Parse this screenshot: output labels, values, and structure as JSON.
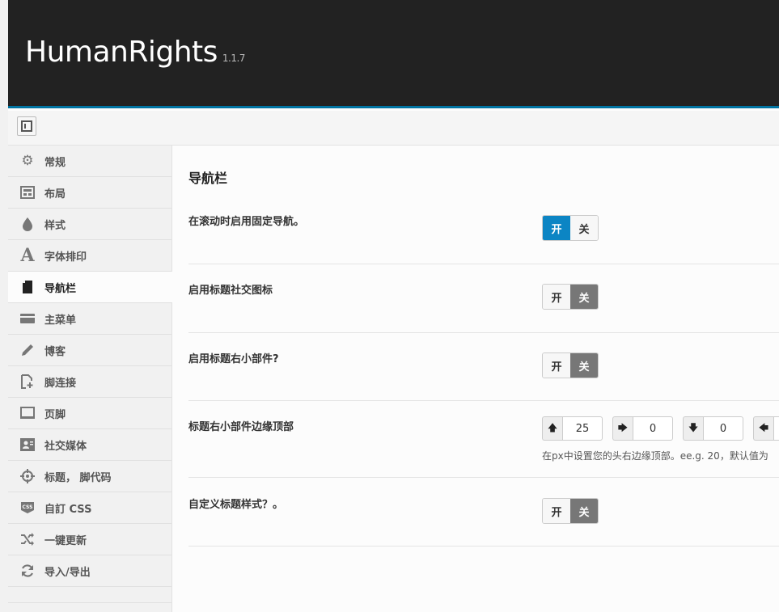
{
  "header": {
    "brand": "HumanRights",
    "version": "1.1.7"
  },
  "sidebar": {
    "items": [
      {
        "label": "常规",
        "icon": "gear-icon",
        "glyph": "⚙"
      },
      {
        "label": "布局",
        "icon": "layout-icon",
        "glyph": "▣"
      },
      {
        "label": "样式",
        "icon": "drop-icon",
        "glyph": "💧"
      },
      {
        "label": "字体排印",
        "icon": "font-icon",
        "glyph": "A"
      },
      {
        "label": "导航栏",
        "icon": "document-icon",
        "glyph": "▮"
      },
      {
        "label": "主菜单",
        "icon": "card-icon",
        "glyph": "▬"
      },
      {
        "label": "博客",
        "icon": "pencil-icon",
        "glyph": "✎"
      },
      {
        "label": "脚连接",
        "icon": "file-add-icon",
        "glyph": "⎘"
      },
      {
        "label": "页脚",
        "icon": "laptop-icon",
        "glyph": "▭"
      },
      {
        "label": "社交媒体",
        "icon": "contact-card-icon",
        "glyph": "▤"
      },
      {
        "label": "标题， 脚代码",
        "icon": "crosshair-icon",
        "glyph": "✥"
      },
      {
        "label": "自訂 CSS",
        "icon": "css-icon",
        "glyph": "CSS"
      },
      {
        "label": "一键更新",
        "icon": "shuffle-icon",
        "glyph": "⤮"
      },
      {
        "label": "导入/导出",
        "icon": "refresh-icon",
        "glyph": "↻"
      }
    ]
  },
  "main": {
    "title": "导航栏",
    "rows": [
      {
        "label": "在滚动时启用固定导航。",
        "on": "开",
        "off": "关",
        "state": "on"
      },
      {
        "label": "启用标题社交图标",
        "on": "开",
        "off": "关",
        "state": "off"
      },
      {
        "label": "启用标题右小部件?",
        "on": "开",
        "off": "关",
        "state": "off"
      },
      {
        "label": "标题右小部件边缘顶部"
      },
      {
        "label": "自定义标题样式？。",
        "on": "开",
        "off": "关",
        "state": "off"
      }
    ],
    "spacing": {
      "top": "25",
      "right": "0",
      "bottom": "0",
      "left": "",
      "desc": "在px中设置您的头右边缘顶部。ee.g. 20，默认值为"
    }
  }
}
